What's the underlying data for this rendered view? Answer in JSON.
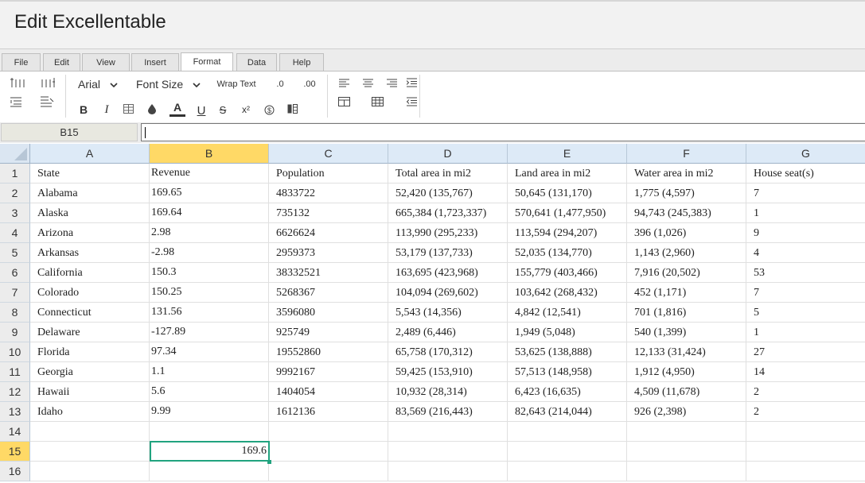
{
  "app": {
    "title": "Edit Excellentable"
  },
  "menu_tabs": [
    "File",
    "Edit",
    "View",
    "Insert",
    "Format",
    "Data",
    "Help"
  ],
  "active_tab": "Format",
  "toolbar": {
    "font_family": "Arial",
    "font_size": "Font Size",
    "wrap_text": "Wrap Text",
    "decrease_decimal": ".0",
    "increase_decimal": ".00",
    "bold": "B",
    "italic": "I",
    "text_color": "A",
    "underline": "U",
    "strikethrough": "S",
    "superscript": "x²",
    "currency": "$"
  },
  "formula_bar": {
    "cell_ref": "B15",
    "value": ""
  },
  "columns": [
    "A",
    "B",
    "C",
    "D",
    "E",
    "F",
    "G"
  ],
  "selected_column": "B",
  "selected_row": 15,
  "rows": [
    [
      "State",
      "Revenue",
      "Population",
      "Total area in mi2",
      "Land area in mi2",
      "Water area in mi2",
      "House seat(s)"
    ],
    [
      "Alabama",
      "169.65",
      "4833722",
      "52,420 (135,767)",
      "50,645 (131,170)",
      "1,775 (4,597)",
      "7"
    ],
    [
      "Alaska",
      "169.64",
      "735132",
      "665,384 (1,723,337)",
      "570,641 (1,477,950)",
      "94,743 (245,383)",
      "1"
    ],
    [
      "Arizona",
      "2.98",
      "6626624",
      "113,990 (295,233)",
      "113,594 (294,207)",
      "396 (1,026)",
      "9"
    ],
    [
      "Arkansas",
      "-2.98",
      "2959373",
      "53,179 (137,733)",
      "52,035 (134,770)",
      "1,143 (2,960)",
      "4"
    ],
    [
      "California",
      "150.3",
      "38332521",
      "163,695 (423,968)",
      "155,779 (403,466)",
      "7,916 (20,502)",
      "53"
    ],
    [
      "Colorado",
      "150.25",
      "5268367",
      "104,094 (269,602)",
      "103,642 (268,432)",
      "452 (1,171)",
      "7"
    ],
    [
      "Connecticut",
      "131.56",
      "3596080",
      "5,543 (14,356)",
      "4,842 (12,541)",
      "701 (1,816)",
      "5"
    ],
    [
      "Delaware",
      "-127.89",
      "925749",
      "2,489 (6,446)",
      "1,949 (5,048)",
      "540 (1,399)",
      "1"
    ],
    [
      "Florida",
      "97.34",
      "19552860",
      "65,758 (170,312)",
      "53,625 (138,888)",
      "12,133 (31,424)",
      "27"
    ],
    [
      "Georgia",
      "1.1",
      "9992167",
      "59,425 (153,910)",
      "57,513 (148,958)",
      "1,912 (4,950)",
      "14"
    ],
    [
      "Hawaii",
      "5.6",
      "1404054",
      "10,932 (28,314)",
      "6,423 (16,635)",
      "4,509 (11,678)",
      "2"
    ],
    [
      "Idaho",
      "9.99",
      "1612136",
      "83,569 (216,443)",
      "82,643 (214,044)",
      "926 (2,398)",
      "2"
    ],
    [
      "",
      "",
      "",
      "",
      "",
      "",
      ""
    ],
    [
      "",
      "169.6",
      "",
      "",
      "",
      "",
      ""
    ],
    [
      "",
      "",
      "",
      "",
      "",
      "",
      ""
    ]
  ]
}
